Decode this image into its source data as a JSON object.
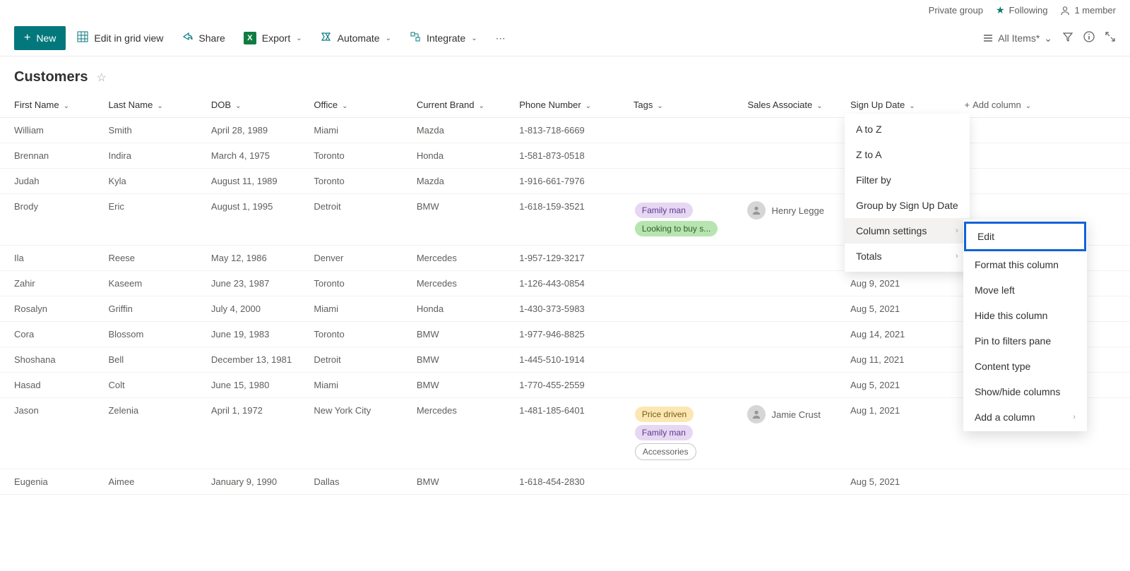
{
  "topbar": {
    "private_group": "Private group",
    "following": "Following",
    "members": "1 member"
  },
  "commands": {
    "new": "New",
    "edit_grid": "Edit in grid view",
    "share": "Share",
    "export": "Export",
    "automate": "Automate",
    "integrate": "Integrate"
  },
  "view": {
    "name": "All Items*"
  },
  "list": {
    "title": "Customers"
  },
  "columns": {
    "first": "First Name",
    "last": "Last Name",
    "dob": "DOB",
    "office": "Office",
    "brand": "Current Brand",
    "phone": "Phone Number",
    "tags": "Tags",
    "sales": "Sales Associate",
    "signup": "Sign Up Date",
    "add": "Add column"
  },
  "rows": [
    {
      "first": "William",
      "last": "Smith",
      "dob": "April 28, 1989",
      "office": "Miami",
      "brand": "Mazda",
      "phone": "1-813-718-6669",
      "tags": [],
      "sales": "",
      "signup": ""
    },
    {
      "first": "Brennan",
      "last": "Indira",
      "dob": "March 4, 1975",
      "office": "Toronto",
      "brand": "Honda",
      "phone": "1-581-873-0518",
      "tags": [],
      "sales": "",
      "signup": ""
    },
    {
      "first": "Judah",
      "last": "Kyla",
      "dob": "August 11, 1989",
      "office": "Toronto",
      "brand": "Mazda",
      "phone": "1-916-661-7976",
      "tags": [],
      "sales": "",
      "signup": ""
    },
    {
      "first": "Brody",
      "last": "Eric",
      "dob": "August 1, 1995",
      "office": "Detroit",
      "brand": "BMW",
      "phone": "1-618-159-3521",
      "tags": [
        {
          "t": "Family man",
          "c": "purple"
        },
        {
          "t": "Looking to buy s...",
          "c": "green"
        }
      ],
      "sales": "Henry Legge",
      "signup": ""
    },
    {
      "first": "Ila",
      "last": "Reese",
      "dob": "May 12, 1986",
      "office": "Denver",
      "brand": "Mercedes",
      "phone": "1-957-129-3217",
      "tags": [],
      "sales": "",
      "signup": ""
    },
    {
      "first": "Zahir",
      "last": "Kaseem",
      "dob": "June 23, 1987",
      "office": "Toronto",
      "brand": "Mercedes",
      "phone": "1-126-443-0854",
      "tags": [],
      "sales": "",
      "signup": "Aug 9, 2021"
    },
    {
      "first": "Rosalyn",
      "last": "Griffin",
      "dob": "July 4, 2000",
      "office": "Miami",
      "brand": "Honda",
      "phone": "1-430-373-5983",
      "tags": [],
      "sales": "",
      "signup": "Aug 5, 2021"
    },
    {
      "first": "Cora",
      "last": "Blossom",
      "dob": "June 19, 1983",
      "office": "Toronto",
      "brand": "BMW",
      "phone": "1-977-946-8825",
      "tags": [],
      "sales": "",
      "signup": "Aug 14, 2021"
    },
    {
      "first": "Shoshana",
      "last": "Bell",
      "dob": "December 13, 1981",
      "office": "Detroit",
      "brand": "BMW",
      "phone": "1-445-510-1914",
      "tags": [],
      "sales": "",
      "signup": "Aug 11, 2021"
    },
    {
      "first": "Hasad",
      "last": "Colt",
      "dob": "June 15, 1980",
      "office": "Miami",
      "brand": "BMW",
      "phone": "1-770-455-2559",
      "tags": [],
      "sales": "",
      "signup": "Aug 5, 2021"
    },
    {
      "first": "Jason",
      "last": "Zelenia",
      "dob": "April 1, 1972",
      "office": "New York City",
      "brand": "Mercedes",
      "phone": "1-481-185-6401",
      "tags": [
        {
          "t": "Price driven",
          "c": "yellow"
        },
        {
          "t": "Family man",
          "c": "purple"
        },
        {
          "t": "Accessories",
          "c": "gray"
        }
      ],
      "sales": "Jamie Crust",
      "signup": "Aug 1, 2021"
    },
    {
      "first": "Eugenia",
      "last": "Aimee",
      "dob": "January 9, 1990",
      "office": "Dallas",
      "brand": "BMW",
      "phone": "1-618-454-2830",
      "tags": [],
      "sales": "",
      "signup": "Aug 5, 2021"
    }
  ],
  "menu1": {
    "az": "A to Z",
    "za": "Z to A",
    "filter": "Filter by",
    "group": "Group by Sign Up Date",
    "colset": "Column settings",
    "totals": "Totals"
  },
  "menu2": {
    "edit": "Edit",
    "format": "Format this column",
    "moveleft": "Move left",
    "hide": "Hide this column",
    "pin": "Pin to filters pane",
    "content": "Content type",
    "showhide": "Show/hide columns",
    "addcol": "Add a column"
  }
}
